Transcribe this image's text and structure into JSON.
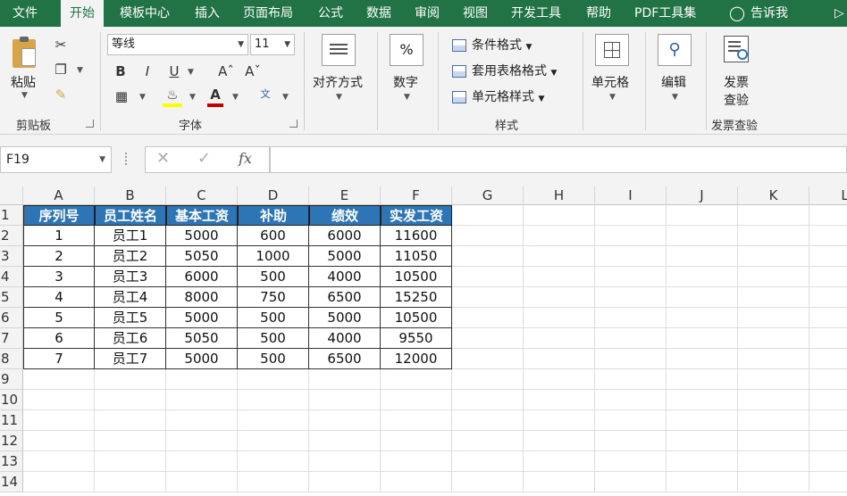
{
  "ribbon_tabs": [
    "文件",
    "开始",
    "模板中心",
    "插入",
    "页面布局",
    "公式",
    "数据",
    "审阅",
    "视图",
    "开发工具",
    "帮助",
    "PDF工具集",
    "告诉我"
  ],
  "active_tab": "开始",
  "clipboard": {
    "paste_label": "粘贴",
    "group_label": "剪贴板"
  },
  "font": {
    "name": "等线",
    "size": "11",
    "group_label": "字体"
  },
  "alignment": {
    "label": "对齐方式"
  },
  "number": {
    "label": "数字",
    "icon": "%"
  },
  "styles": {
    "conditional_format": "条件格式",
    "table_format": "套用表格格式",
    "cell_styles": "单元格样式",
    "group_label": "样式"
  },
  "cells": {
    "label": "单元格"
  },
  "editing": {
    "label": "编辑"
  },
  "invoice": {
    "label_line1": "发票",
    "label_line2": "查验",
    "group_label": "发票查验"
  },
  "name_box": "F19",
  "columns": [
    "A",
    "B",
    "C",
    "D",
    "E",
    "F",
    "G",
    "H",
    "I",
    "J",
    "K",
    "L"
  ],
  "rows": [
    "1",
    "2",
    "3",
    "4",
    "5",
    "6",
    "7",
    "8",
    "9",
    "10",
    "11",
    "12",
    "13",
    "14"
  ],
  "table": {
    "headers": [
      "序列号",
      "员工姓名",
      "基本工资",
      "补助",
      "绩效",
      "实发工资"
    ],
    "rows": [
      [
        "1",
        "员工1",
        "5000",
        "600",
        "6000",
        "11600"
      ],
      [
        "2",
        "员工2",
        "5050",
        "1000",
        "5000",
        "11050"
      ],
      [
        "3",
        "员工3",
        "6000",
        "500",
        "4000",
        "10500"
      ],
      [
        "4",
        "员工4",
        "8000",
        "750",
        "6500",
        "15250"
      ],
      [
        "5",
        "员工5",
        "5000",
        "500",
        "5000",
        "10500"
      ],
      [
        "6",
        "员工6",
        "5050",
        "500",
        "4000",
        "9550"
      ],
      [
        "7",
        "员工7",
        "5000",
        "500",
        "6500",
        "12000"
      ]
    ]
  },
  "colors": {
    "ribbon_green": "#217346",
    "header_fill": "#2e75b6"
  }
}
